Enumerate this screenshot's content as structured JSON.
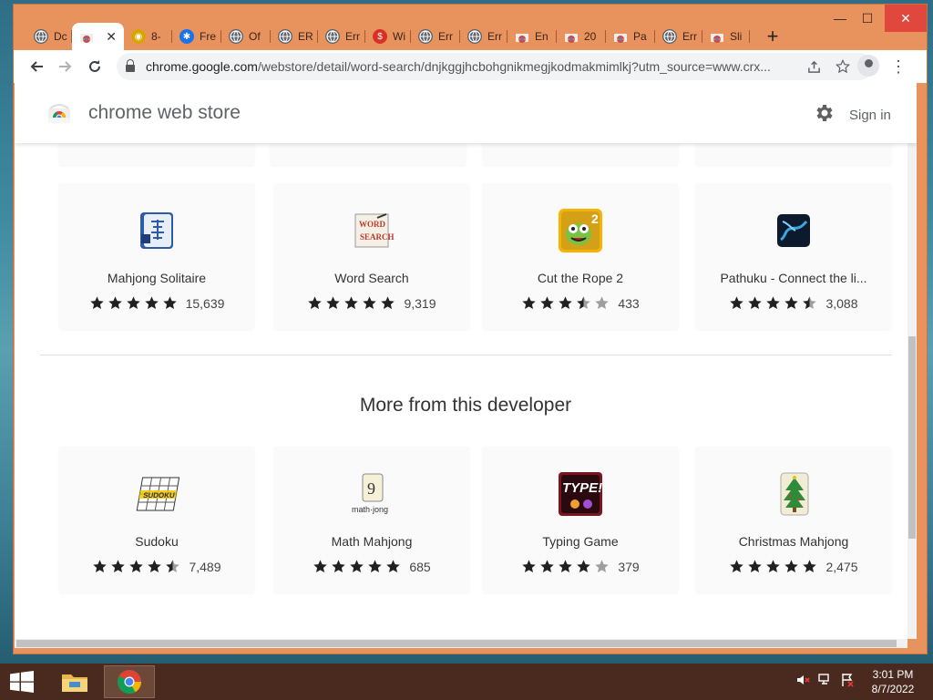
{
  "browser": {
    "tabs": [
      {
        "label": "Dc",
        "icon": "globe-icon",
        "color": "#5f6368"
      },
      {
        "label": "",
        "icon": "chrome-web-store-icon",
        "color": "#ffffff",
        "active": true
      },
      {
        "label": "8-",
        "icon": "puzzle-icon",
        "color": "#d9a400"
      },
      {
        "label": "Fre",
        "icon": "bug-icon",
        "color": "#1a73e8"
      },
      {
        "label": "Of",
        "icon": "globe-icon",
        "color": "#5f6368"
      },
      {
        "label": "ER",
        "icon": "globe-icon",
        "color": "#5f6368"
      },
      {
        "label": "Err",
        "icon": "globe-icon",
        "color": "#5f6368"
      },
      {
        "label": "Wi",
        "icon": "dollar-icon",
        "color": "#d93025"
      },
      {
        "label": "Err",
        "icon": "globe-icon",
        "color": "#5f6368"
      },
      {
        "label": "Err",
        "icon": "globe-icon",
        "color": "#5f6368"
      },
      {
        "label": "En",
        "icon": "chrome-web-store-icon",
        "color": "#ffffff"
      },
      {
        "label": "20",
        "icon": "chrome-web-store-icon",
        "color": "#ffffff"
      },
      {
        "label": "Pa",
        "icon": "chrome-web-store-icon",
        "color": "#ffffff"
      },
      {
        "label": "Err",
        "icon": "globe-icon",
        "color": "#5f6368"
      },
      {
        "label": "Sli",
        "icon": "chrome-web-store-icon",
        "color": "#ffffff"
      }
    ],
    "new_tab": "+",
    "window_controls": {
      "minimize": "—",
      "maximize": "☐",
      "close": "✕"
    },
    "url_host": "chrome.google.com",
    "url_path": "/webstore/detail/word-search/dnjkggjhcbohgnikmegjkodmakmimlkj?utm_source=www.crx..."
  },
  "store": {
    "title": "chrome web store",
    "sign_in": "Sign in"
  },
  "related_apps": [
    {
      "name": "Mahjong Solitaire",
      "rating": 5,
      "count": "15,639",
      "icon": "mahjong-tile-icon"
    },
    {
      "name": "Word Search",
      "rating": 5,
      "count": "9,319",
      "icon": "word-search-icon"
    },
    {
      "name": "Cut the Rope 2",
      "rating": 3.5,
      "count": "433",
      "icon": "cut-the-rope-icon"
    },
    {
      "name": "Pathuku - Connect the li...",
      "rating": 4.5,
      "count": "3,088",
      "icon": "pathuku-icon"
    }
  ],
  "section_title": "More from this developer",
  "developer_apps": [
    {
      "name": "Sudoku",
      "rating": 4.5,
      "count": "7,489",
      "icon": "sudoku-icon"
    },
    {
      "name": "Math Mahjong",
      "rating": 5,
      "count": "685",
      "icon": "math-mahjong-icon",
      "icon_text": "math·jong"
    },
    {
      "name": "Typing Game",
      "rating": 4,
      "count": "379",
      "icon": "typing-game-icon",
      "icon_text": "TYPE!"
    },
    {
      "name": "Christmas Mahjong",
      "rating": 5,
      "count": "2,475",
      "icon": "christmas-mahjong-icon"
    }
  ],
  "math_mahjong_digit": "9",
  "taskbar": {
    "time": "3:01 PM",
    "date": "8/7/2022"
  }
}
